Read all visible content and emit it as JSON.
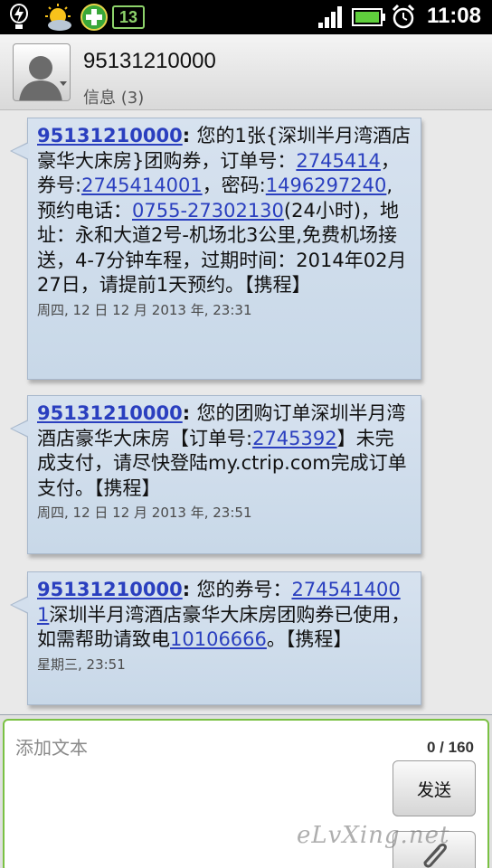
{
  "status_bar": {
    "time": "11:08",
    "icons": [
      "usb-debug-icon",
      "weather-icon",
      "add-app-icon",
      "sim-icon",
      "signal-icon",
      "battery-icon",
      "alarm-icon"
    ],
    "sim_label": "13"
  },
  "header": {
    "contact_name": "95131210000",
    "subtitle": "信息 (3)"
  },
  "messages": [
    {
      "sender": "95131210000",
      "parts": [
        {
          "t": "您的1张{深圳半月湾酒店豪华大床房}团购券，订单号："
        },
        {
          "t": "2745414",
          "link": true
        },
        {
          "t": "，券号:"
        },
        {
          "t": "2745414001",
          "link": true
        },
        {
          "t": "，密码:"
        },
        {
          "t": "1496297240",
          "link": true
        },
        {
          "t": ",预约电话："
        },
        {
          "t": "0755-27302130",
          "link": true
        },
        {
          "t": "(24小时)，地址：永和大道2号-机场北3公里,免费机场接送，4-7分钟车程，过期时间：2014年02月27日，请提前1天预约。【携程】"
        }
      ],
      "time": "周四, 12 日 12 月 2013 年, 23:31"
    },
    {
      "sender": "95131210000",
      "parts": [
        {
          "t": "您的团购订单深圳半月湾酒店豪华大床房【订单号:"
        },
        {
          "t": "2745392",
          "link": true
        },
        {
          "t": "】未完成支付，请尽快登陆my.ctrip.com完成订单支付。【携程】"
        }
      ],
      "time": "周四, 12 日 12 月 2013 年, 23:51"
    },
    {
      "sender": "95131210000",
      "parts": [
        {
          "t": "您的券号："
        },
        {
          "t": "2745414001",
          "link": true
        },
        {
          "t": "深圳半月湾酒店豪华大床房团购券已使用，如需帮助请致电"
        },
        {
          "t": "10106666",
          "link": true
        },
        {
          "t": "。【携程】"
        }
      ],
      "time": "星期三, 23:51"
    }
  ],
  "compose": {
    "placeholder": "添加文本",
    "counter": "0 / 160",
    "send_label": "发送",
    "watermark": "eLvXing.net"
  },
  "colors": {
    "accent_green": "#7ac143",
    "link_blue": "#2a3fbf",
    "bubble_bg": "#c8d8e8"
  }
}
